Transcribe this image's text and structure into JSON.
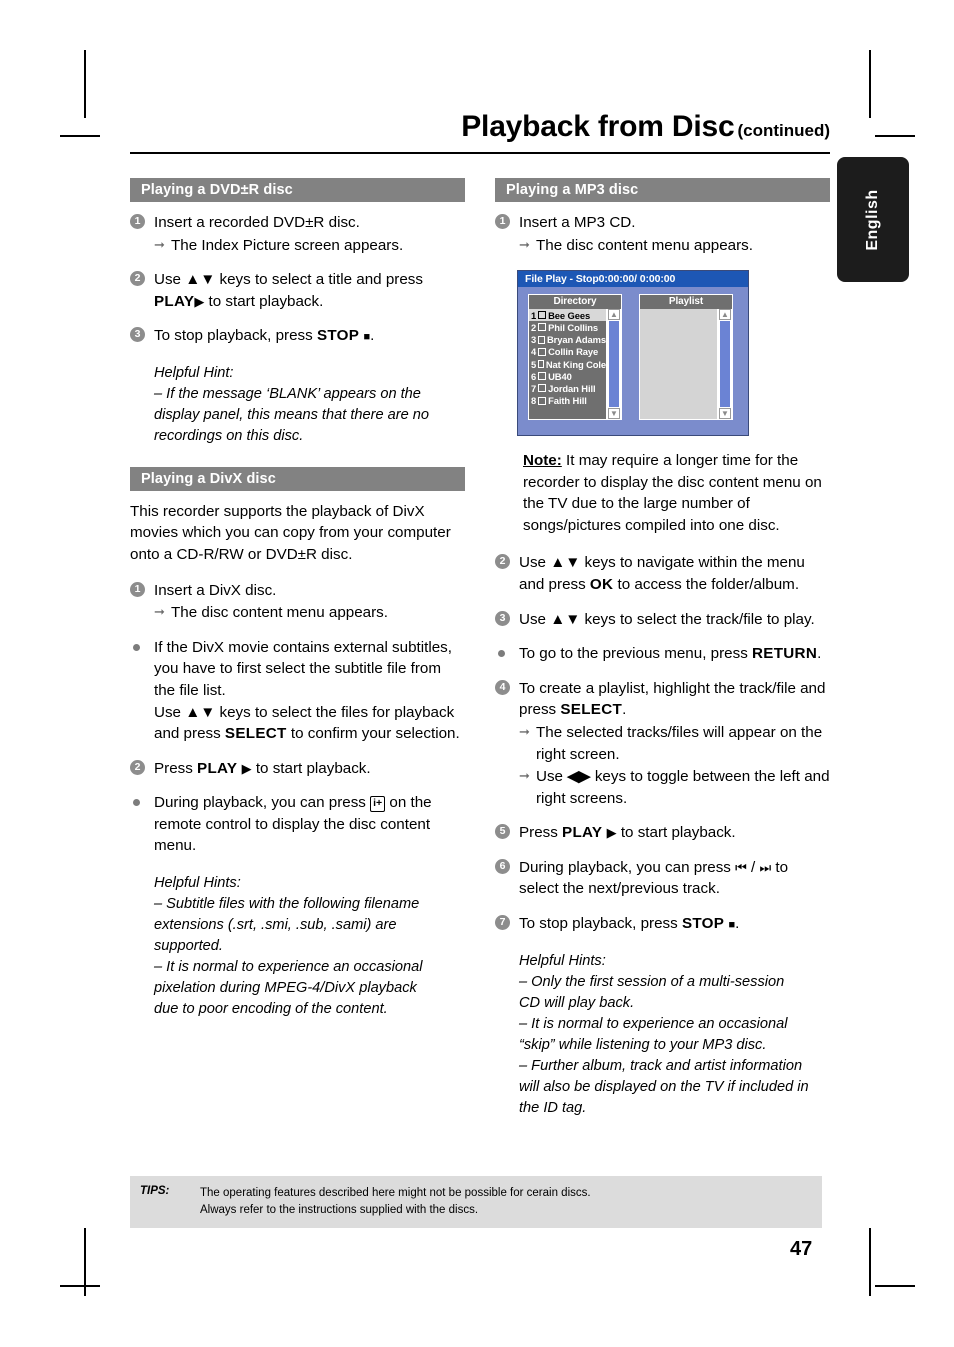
{
  "header": {
    "title": "Playback from Disc",
    "continued": "(continued)"
  },
  "side_tab": {
    "label": "English"
  },
  "left_column": {
    "section1": {
      "heading": "Playing a DVD±R disc",
      "steps": [
        {
          "marker": "1",
          "text": "Insert a recorded DVD±R disc.",
          "sub": "The Index Picture screen appears."
        },
        {
          "marker": "2",
          "text_a": "Use ▲▼ keys to select a title and press ",
          "bold": "PLAY",
          "glyph": "▶",
          "text_b": " to start playback."
        },
        {
          "marker": "3",
          "text_a": "To stop playback, press ",
          "bold": "STOP",
          "glyph": "■",
          "text_b": "."
        }
      ],
      "hint_title": "Helpful Hint:",
      "hint_lines": [
        "– If the message ‘BLANK’ appears on the",
        "display panel, this means that there are no",
        "recordings on this disc."
      ]
    },
    "section2": {
      "heading": "Playing a DivX disc",
      "intro": "This recorder supports the playback of DivX movies which you can copy from your computer onto a CD-R/RW or DVD±R disc.",
      "step1": {
        "marker": "1",
        "text": "Insert a DivX disc.",
        "sub": "The disc content menu appears."
      },
      "bullet1_line1": "If the DivX movie contains external subtitles, you have to first select the subtitle file from the file list.",
      "bullet1_line2_a": "Use ▲▼ keys to select the files for playback and press ",
      "bullet1_bold": "SELECT",
      "bullet1_line2_b": " to confirm your selection.",
      "step2": {
        "marker": "2",
        "text_a": "Press ",
        "bold": "PLAY",
        "glyph": "▶",
        "text_b": " to start playback."
      },
      "bullet2_a": "During playback, you can press ",
      "bullet2_icon": "i+",
      "bullet2_b": " on the remote control to display the disc content menu.",
      "hint_title": "Helpful Hints:",
      "hint_lines": [
        "– Subtitle files with the following filename",
        "extensions (.srt, .smi, .sub, .sami) are",
        "supported.",
        "– It is normal to experience an occasional",
        "pixelation during MPEG-4/DivX playback",
        "due to poor encoding of the content."
      ]
    }
  },
  "right_column": {
    "section1": {
      "heading": "Playing a MP3 disc",
      "step1": {
        "marker": "1",
        "text": "Insert a MP3 CD.",
        "sub": "The disc content menu appears."
      },
      "note_label": "Note:",
      "note_text": " It may require a longer time for the recorder to display the disc content menu on the TV due to the large number of songs/pictures compiled into one disc.",
      "step2": {
        "marker": "2",
        "text_a": "Use ▲▼ keys to navigate within the menu and press ",
        "bold": "OK",
        "text_b": " to access the folder/album."
      },
      "step3": {
        "marker": "3",
        "text": "Use ▲▼ keys to select the track/file to play."
      },
      "bullet1_a": "To go to the previous menu, press ",
      "bullet1_bold": "RETURN",
      "bullet1_b": ".",
      "step4": {
        "marker": "4",
        "text_a": "To create a playlist, highlight the track/file and press ",
        "bold": "SELECT",
        "text_b": ".",
        "sub1": "The selected tracks/files will appear on the right screen.",
        "sub2_a": "Use ",
        "sub2_glyph": "◀▶",
        "sub2_b": " keys to toggle between the left and right screens."
      },
      "step5": {
        "marker": "5",
        "text_a": "Press ",
        "bold": "PLAY",
        "glyph": "▶",
        "text_b": " to start playback."
      },
      "step6": {
        "marker": "6",
        "text_a": "During playback, you can press ",
        "glyph_a": "⏮",
        "sep": " / ",
        "glyph_b": "⏭",
        "text_b": " to select the next/previous track."
      },
      "step7": {
        "marker": "7",
        "text_a": "To stop playback, press ",
        "bold": "STOP",
        "glyph": "■",
        "text_b": "."
      },
      "hint_title": "Helpful Hints:",
      "hint_lines": [
        "– Only the first session of a multi-session",
        "CD will play back.",
        "– It is normal to experience an occasional",
        "“skip” while listening to your MP3 disc.",
        "– Further album, track and artist information",
        "will also be displayed on the TV if included in",
        "the ID tag."
      ]
    },
    "tv_screen": {
      "titlebar": "File Play - Stop0:00:00/ 0:00:00",
      "directory_header": "Directory",
      "playlist_header": "Playlist",
      "directory_items": [
        {
          "index": "1",
          "name": "Bee Gees",
          "selected": true
        },
        {
          "index": "2",
          "name": "Phil Collins",
          "selected": false
        },
        {
          "index": "3",
          "name": "Bryan Adams",
          "selected": false
        },
        {
          "index": "4",
          "name": "Collin Raye",
          "selected": false
        },
        {
          "index": "5",
          "name": "Nat King Cole",
          "selected": false
        },
        {
          "index": "6",
          "name": "UB40",
          "selected": false
        },
        {
          "index": "7",
          "name": "Jordan Hill",
          "selected": false
        },
        {
          "index": "8",
          "name": "Faith Hill",
          "selected": false
        }
      ],
      "playlist_items": [],
      "scroll_up_glyph": "▲",
      "scroll_down_glyph": "▼",
      "colors": {
        "titlebar": "#1d57b5",
        "background": "#7b8ccc",
        "panel_header": "#6f6f6f",
        "scroll_thumb": "#6b83d4"
      }
    }
  },
  "tips": {
    "label": "TIPS:",
    "line1": "The operating features described here might not be possible for cerain discs.",
    "line2": "Always refer to the instructions supplied with the discs."
  },
  "page_number": "47"
}
